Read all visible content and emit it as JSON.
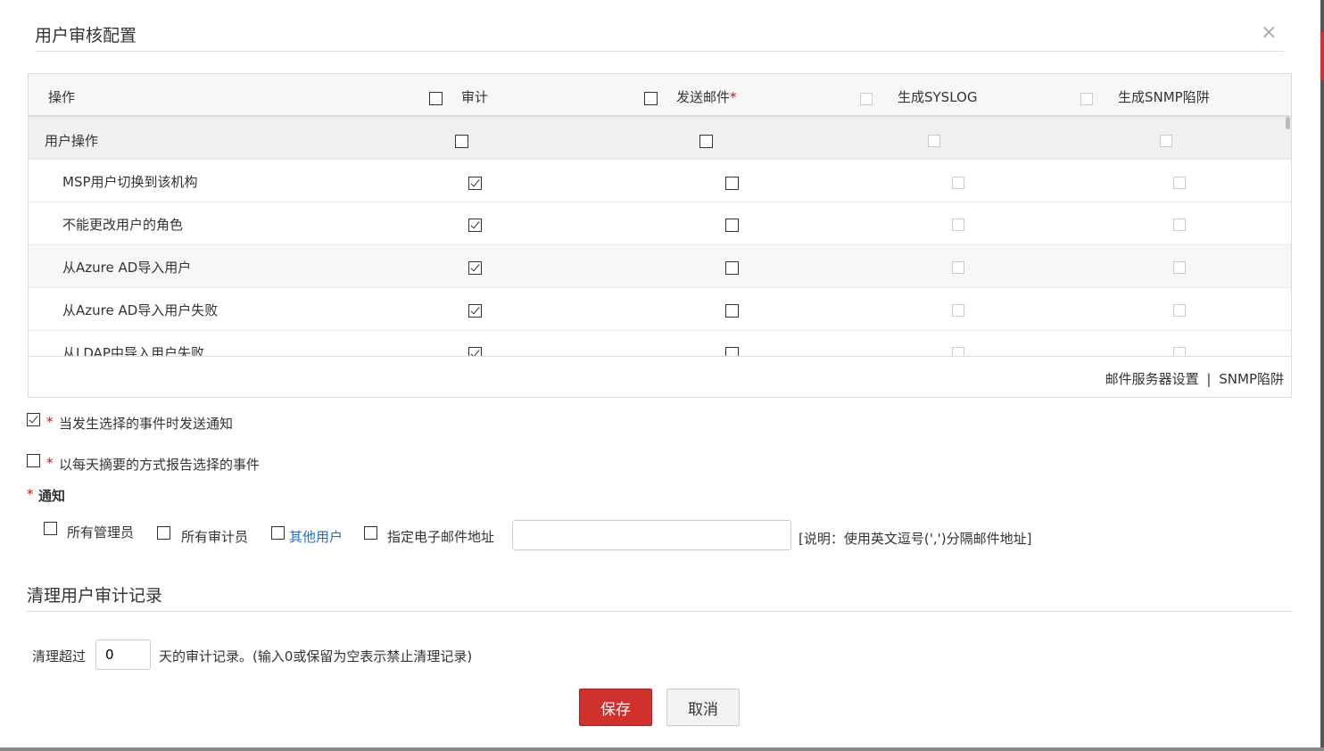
{
  "dialog": {
    "title": "用户审核配置",
    "close_icon": "×"
  },
  "table": {
    "headers": [
      "操作",
      "审计",
      "发送邮件",
      "生成SYSLOG",
      "生成SNMP陷阱"
    ],
    "required_mark": "*",
    "group": "用户操作",
    "rows": [
      {
        "label": "MSP用户切换到该机构",
        "audit": true
      },
      {
        "label": "不能更改用户的角色",
        "audit": true
      },
      {
        "label": "从Azure AD导入用户",
        "audit": true
      },
      {
        "label": "从Azure AD导入用户失败",
        "audit": true
      },
      {
        "label": "从LDAP中导入用户失败",
        "audit": true
      }
    ],
    "footer_links": [
      "邮件服务器设置",
      "SNMP陷阱"
    ],
    "separator": "|"
  },
  "options": {
    "send_notify": {
      "label": "当发生选择的事件时发送通知",
      "checked": true
    },
    "daily_digest": {
      "label": "以每天摘要的方式报告选择的事件",
      "checked": false
    }
  },
  "notify": {
    "title": "通知",
    "all_admins": "所有管理员",
    "all_auditors": "所有审计员",
    "other_users": "其他用户",
    "specify_email": "指定电子邮件地址",
    "email_value": "",
    "note": "[说明：使用英文逗号(',')分隔邮件地址]"
  },
  "cleanup": {
    "title": "清理用户审计记录",
    "prefix": "清理超过",
    "days": "0",
    "suffix": "天的审计记录。(输入0或保留为空表示禁止清理记录)"
  },
  "buttons": {
    "save": "保存",
    "cancel": "取消"
  }
}
